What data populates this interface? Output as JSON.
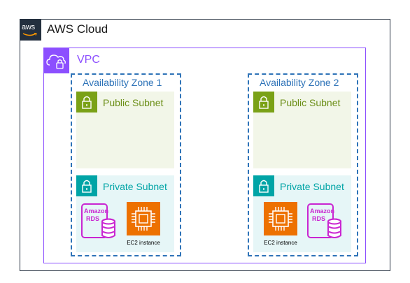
{
  "cloud": {
    "title": "AWS Cloud",
    "badge_text": "aws",
    "icon": "aws-logo-icon",
    "border_color": "#232f3e"
  },
  "vpc": {
    "title": "VPC",
    "icon": "vpc-cloud-lock-icon",
    "color": "#8c4fff"
  },
  "zones": [
    {
      "title": "Availability Zone 1",
      "public_subnet": {
        "title": "Public Subnet",
        "icon": "padlock-icon"
      },
      "private_subnet": {
        "title": "Private Subnet",
        "icon": "padlock-icon",
        "rds": {
          "line1": "Amazon",
          "line2": "RDS",
          "icon": "rds-database-icon"
        },
        "ec2": {
          "label": "EC2 instance",
          "icon": "ec2-chip-icon"
        }
      }
    },
    {
      "title": "Availability Zone 2",
      "public_subnet": {
        "title": "Public Subnet",
        "icon": "padlock-icon"
      },
      "private_subnet": {
        "title": "Private Subnet",
        "icon": "padlock-icon",
        "rds": {
          "line1": "Amazon",
          "line2": "RDS",
          "icon": "rds-database-icon"
        },
        "ec2": {
          "label": "EC2 instance",
          "icon": "ec2-chip-icon"
        }
      }
    }
  ],
  "colors": {
    "az": "#2e73b8",
    "public": "#7aa116",
    "private": "#00a4a6",
    "rds": "#c925d1",
    "ec2": "#ed7100"
  }
}
